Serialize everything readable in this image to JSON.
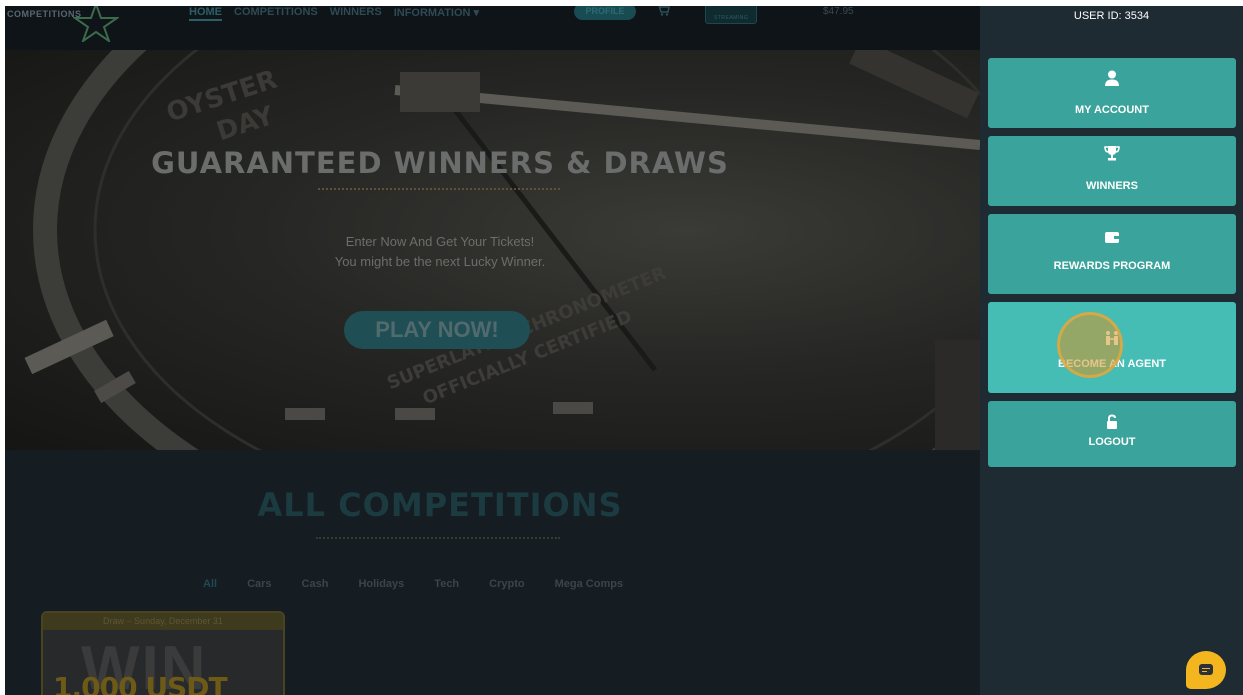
{
  "nav": {
    "logo_text": "COMPETITIONS",
    "links": [
      "HOME",
      "COMPETITIONS",
      "WINNERS",
      "INFORMATION"
    ],
    "profile_label": "PROFILE",
    "live_label": "STREAMING",
    "price": "$47.95"
  },
  "hero": {
    "title": "GUARANTEED WINNERS & DRAWS",
    "line1": "Enter Now And Get Your Tickets!",
    "line2": "You might be the next Lucky Winner.",
    "cta": "PLAY NOW!"
  },
  "competitions": {
    "title": "ALL COMPETITIONS",
    "filters": [
      "All",
      "Cars",
      "Cash",
      "Holidays",
      "Tech",
      "Crypto",
      "Mega Comps"
    ],
    "card": {
      "draw_date": "Draw – Sunday, December 31",
      "bg_text": "WIN",
      "prize": "1,000 USDT"
    }
  },
  "sidebar": {
    "user_id": "USER ID: 3534",
    "items": [
      {
        "label": "MY ACCOUNT",
        "icon": "user-icon"
      },
      {
        "label": "WINNERS",
        "icon": "trophy-icon"
      },
      {
        "label": "REWARDS PROGRAM",
        "icon": "wallet-icon"
      },
      {
        "label": "BECOME AN AGENT",
        "icon": "agent-icon"
      },
      {
        "label": "LOGOUT",
        "icon": "unlock-icon"
      }
    ]
  },
  "colors": {
    "menu_teal": "#3aa39b",
    "menu_hover": "#45bdb4",
    "click_marker": "#d69628",
    "chat_button": "#f3b61f"
  }
}
